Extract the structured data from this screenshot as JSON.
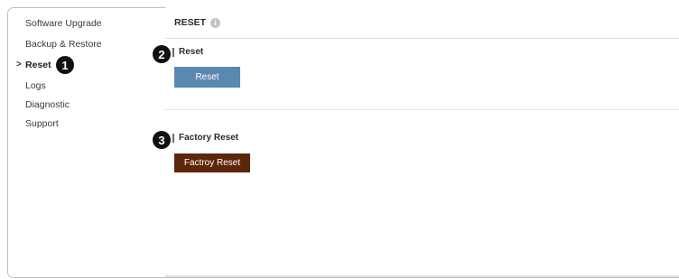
{
  "sidebar": {
    "items": [
      {
        "label": "Software Upgrade",
        "active": false
      },
      {
        "label": "Backup & Restore",
        "active": false
      },
      {
        "label": "Reset",
        "active": true
      },
      {
        "label": "Logs",
        "active": false
      },
      {
        "label": "Diagnostic",
        "active": false
      },
      {
        "label": "Support",
        "active": false
      }
    ],
    "active_marker": ">"
  },
  "panel": {
    "title": "RESET",
    "info_icon": "i",
    "sections": {
      "reset": {
        "label": "Reset",
        "button_label": "Reset"
      },
      "factory_reset": {
        "label": "Factory Reset",
        "button_label": "Factroy Reset"
      }
    }
  },
  "callouts": [
    "1",
    "2",
    "3"
  ],
  "colors": {
    "reset_button": "#5b88b0",
    "factory_reset_button": "#5c2608",
    "content_background": "#dde2e7",
    "callout_badge": "#111111"
  }
}
